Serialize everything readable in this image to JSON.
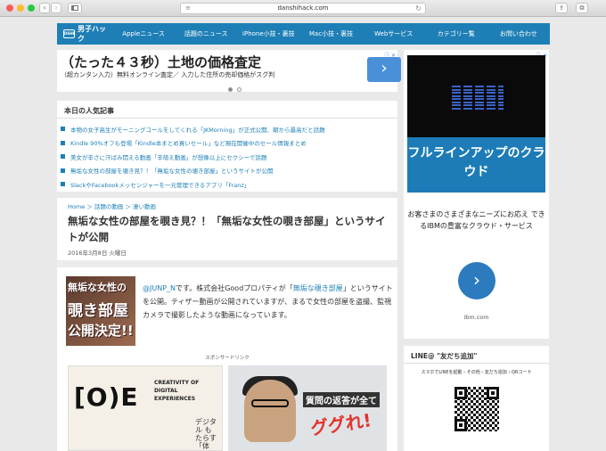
{
  "browser": {
    "url": "danshihack.com",
    "back_glyph": "‹",
    "forward_glyph": "›",
    "reload_glyph": "↻",
    "share_glyph": "⇪",
    "tabs_glyph": "⧉"
  },
  "site": {
    "logo_text": "男子ハック",
    "logo_mark": "DSHK",
    "nav": [
      "Appleニュース",
      "話題のニュース",
      "iPhone小技・裏技",
      "Mac小技・裏技",
      "Webサービス",
      "カテゴリー覧",
      "お問い合わせ"
    ],
    "accent": "#1e7fb6"
  },
  "top_ad": {
    "title": "（たった４３秒）土地の価格査定",
    "subtitle": "（超カンタン入力）無料オンライン査定／ 入力した住所の売却価格がスグ判",
    "button_glyph": "›",
    "adchoices": "ⓘ ✕"
  },
  "popular": {
    "title": "本日の人気記事",
    "items": [
      "本物の女子高生がモーニングコールをしてくれる「JKMorning」が正式公開、朝から最高だと話題",
      "Kindle 90%オフも登場「Kindle本まとめ買いセール」など現在開催中のセール情報まとめ",
      "美女が辛さに汗ばみ悶える動画「辛萌え動画」が想像以上にセクシーで話題",
      "無垢な女性の部屋を覗き見？！「無垢な女性の覗き部屋」というサイトが公開",
      "SlackやFacebookメッセンジャーを一元管理できるアプリ「Franz」"
    ]
  },
  "article": {
    "breadcrumb": "Home ＞ 話題の動画 ＞ 凄い動画",
    "title": "無垢な女性の部屋を覗き見？！「無垢な女性の覗き部屋」というサイトが公開",
    "date": "2016年3月8日 火曜日",
    "thumb_lines": [
      "無垢な女性の",
      "覗き部屋",
      "公開決定!!"
    ],
    "intro_link1": "@JUNP_N",
    "intro_text1": "です。株式会社Goodプロパティが「",
    "intro_link2": "無垢な覗き部屋",
    "intro_text2": "」というサイトを公開。ティザー動画が公開されていますが、まるで女性の部屋を盗撮、監視カメラで撮影したような動画になっています。",
    "sponsor_label": "スポンサードリンク",
    "ad1_logo": "[O)E",
    "ad1_sub": "CREATIVITY OF DIGITAL EXPERIENCES",
    "ad1_vert": "デジタル もたらす 「体験」",
    "ad2_t1": "質問の返答が全て",
    "ad2_t2": "ググれ!"
  },
  "side_ad": {
    "brand": "IBM",
    "headline": "フルラインアップのクラウド",
    "body": "お客さまのさまざまなニーズにお応え できるIBMの豊富なクラウド・サービス",
    "button_glyph": "›",
    "url": "ibm.com",
    "adchoices": "ⓘ ✕"
  },
  "line_box": {
    "title": "LINE@ \"友だち追加\"",
    "steps": "スマホでLINEを起動 › その他 › 友だち追加 › QRコード"
  }
}
